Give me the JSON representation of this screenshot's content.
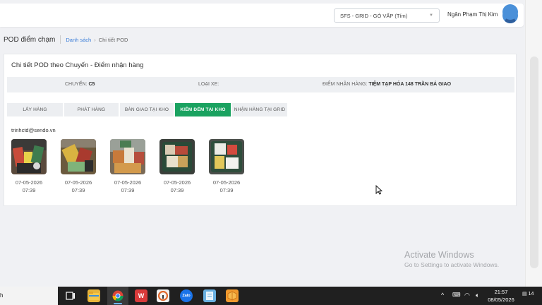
{
  "header": {
    "selector_value": "SFS - GRID - GÒ VẤP (Tím)",
    "user_name": "Ngân Phạm Thị Kim"
  },
  "breadcrumb": {
    "page_title": "POD điểm chạm",
    "link": "Danh sách",
    "separator": "›",
    "current": "Chi tiết POD"
  },
  "card": {
    "title": "Chi tiết POD theo Chuyến - Điểm nhận hàng",
    "info": {
      "trip_label": "CHUYẾN:",
      "trip_value": "C5",
      "vehicle_label": "LOẠI XE:",
      "vehicle_value": "",
      "point_label": "ĐIỂM NHẬN HÀNG:",
      "point_value": "TIỆM TẠP HÓA 148 TRẦN BÁ GIAO"
    },
    "tabs": [
      {
        "label": "LẤY HÀNG",
        "active": false
      },
      {
        "label": "PHÁT HÀNG",
        "active": false
      },
      {
        "label": "BÀN GIAO TẠI KHO",
        "active": false
      },
      {
        "label": "KIỂM ĐẾM TẠI KHO",
        "active": true
      },
      {
        "label": "NHẬN HÀNG TẠI GRID",
        "active": false
      }
    ],
    "email": "trinhctd@sendo.vn",
    "photos": [
      {
        "date": "07-05-2026",
        "time": "07:39"
      },
      {
        "date": "07-05-2026",
        "time": "07:39"
      },
      {
        "date": "07-05-2026",
        "time": "07:39"
      },
      {
        "date": "07-05-2026",
        "time": "07:39"
      },
      {
        "date": "07-05-2026",
        "time": "07:39"
      }
    ]
  },
  "watermark": {
    "title": "Activate Windows",
    "subtitle": "Go to Settings to activate Windows."
  },
  "taskbar": {
    "left_text": "h",
    "time": "21:57",
    "date": "08/05/2026",
    "notification_count": "14",
    "apps": [
      "task-view-icon",
      "file-explorer-icon",
      "chrome-icon",
      "wps-icon",
      "cp-app-icon",
      "zalo-icon",
      "notepad-icon",
      "box-app-icon"
    ]
  },
  "colors": {
    "accent": "#1aa260",
    "link": "#3b7dd8"
  }
}
